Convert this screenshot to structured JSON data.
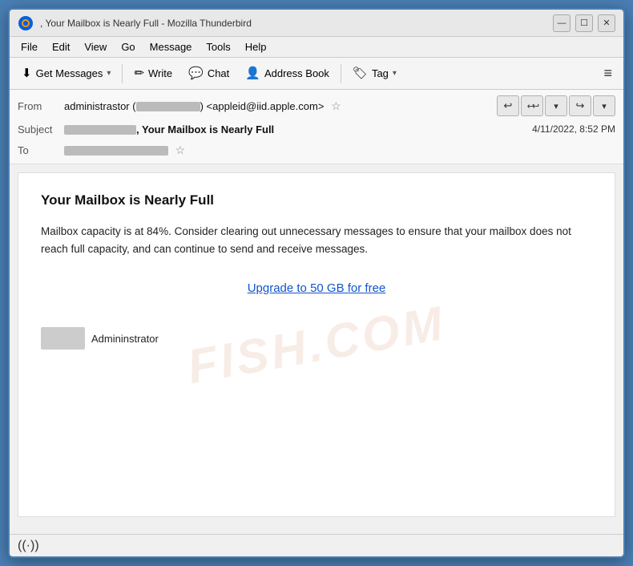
{
  "window": {
    "title": ", Your Mailbox is Nearly Full - Mozilla Thunderbird",
    "logo_label": "thunderbird-logo"
  },
  "title_controls": {
    "minimize_label": "—",
    "maximize_label": "☐",
    "close_label": "✕"
  },
  "menu": {
    "items": [
      "File",
      "Edit",
      "View",
      "Go",
      "Message",
      "Tools",
      "Help"
    ]
  },
  "toolbar": {
    "get_messages_label": "Get Messages",
    "write_label": "Write",
    "chat_label": "Chat",
    "address_book_label": "Address Book",
    "tag_label": "Tag",
    "hamburger_label": "≡"
  },
  "email_header": {
    "from_label": "From",
    "from_value": "administrastor (",
    "from_email": ") <appleid@iid.apple.com>",
    "subject_label": "Subject",
    "subject_value": ", Your Mailbox is Nearly Full",
    "timestamp": "4/11/2022, 8:52 PM",
    "to_label": "To",
    "to_value": ""
  },
  "email_body": {
    "title": "Your Mailbox is Nearly Full",
    "paragraph": "Mailbox capacity is at 84%. Consider clearing out unnecessary messages to ensure that your mailbox does not reach full capacity, and can continue to send and receive messages.",
    "upgrade_link_text": "Upgrade to 50 GB for free",
    "signature_name": "Admininstrator",
    "watermark": "FISH.COM"
  },
  "status_bar": {
    "icon": "((·))"
  },
  "nav_buttons": {
    "reply_label": "↩",
    "reply_all_label": "↩↩",
    "dropdown_label": "▾",
    "forward_label": "↪",
    "more_label": "▾"
  }
}
